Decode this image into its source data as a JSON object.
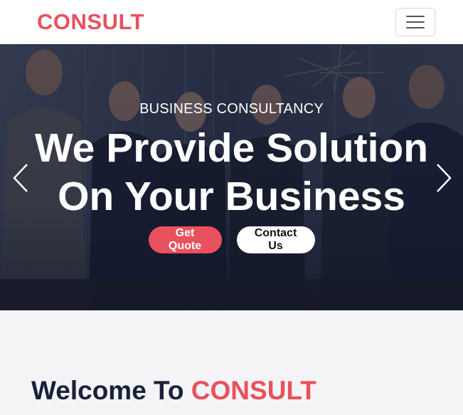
{
  "navbar": {
    "brand": "CONSULT",
    "toggler_icon": "hamburger-menu-icon"
  },
  "hero": {
    "eyebrow": "Business Consultancy",
    "title_line1": "We Provide Solution",
    "title_line2": "On Your Business",
    "primary_button": "Get Quote",
    "secondary_button": "Contact Us",
    "prev_icon": "chevron-left-icon",
    "next_icon": "chevron-right-icon"
  },
  "welcome": {
    "prefix": "Welcome To",
    "brand": "CONSULT"
  },
  "colors": {
    "accent": "#e9515d",
    "dark": "#17213a",
    "hero_overlay": "#1b2236"
  }
}
